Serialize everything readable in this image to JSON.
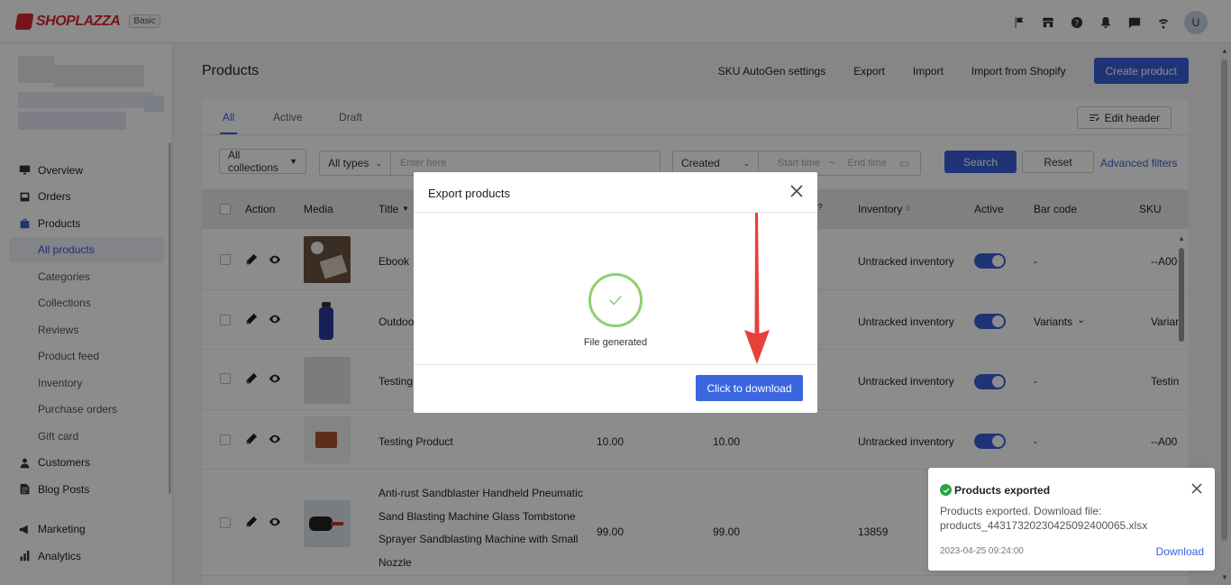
{
  "topbar": {
    "logo_text": "SHOPLAZZA",
    "plan_badge": "Basic",
    "icons": [
      "flag-icon",
      "store-icon",
      "help-icon",
      "bell-icon",
      "chat-icon",
      "wifi-icon"
    ],
    "avatar_initial": "U"
  },
  "sidebar": {
    "items": [
      {
        "label": "Overview",
        "icon": "overview-icon"
      },
      {
        "label": "Orders",
        "icon": "orders-icon"
      },
      {
        "label": "Products",
        "icon": "products-icon"
      }
    ],
    "product_subitems": [
      "All products",
      "Categories",
      "Collections",
      "Reviews",
      "Product feed",
      "Inventory",
      "Purchase orders",
      "Gift card"
    ],
    "lower_items": [
      {
        "label": "Customers",
        "icon": "customers-icon"
      },
      {
        "label": "Blog Posts",
        "icon": "blog-icon"
      }
    ],
    "bottom_items": [
      {
        "label": "Marketing",
        "icon": "marketing-icon"
      },
      {
        "label": "Analytics",
        "icon": "analytics-icon"
      }
    ]
  },
  "page": {
    "title": "Products",
    "actions": [
      "SKU AutoGen settings",
      "Export",
      "Import",
      "Import from Shopify"
    ],
    "create_button": "Create product"
  },
  "tabs": [
    "All",
    "Active",
    "Draft"
  ],
  "edit_header": "Edit header",
  "filters": {
    "collections": "All collections",
    "types": "All types",
    "search_placeholder": "Enter here",
    "date_field": "Created",
    "start_placeholder": "Start time",
    "tilde": "~",
    "end_placeholder": "End time",
    "search_button": "Search",
    "reset_button": "Reset",
    "advanced": "Advanced filters"
  },
  "table": {
    "headers": {
      "action": "Action",
      "media": "Media",
      "title": "Title",
      "inventory": "Inventory",
      "active": "Active",
      "barcode": "Bar code",
      "sku": "SKU"
    },
    "rows": [
      {
        "title": "Ebook",
        "price": "",
        "compare": "",
        "inventory": "Untracked inventory",
        "barcode": "-",
        "sku": "--A00"
      },
      {
        "title": "Outdoo",
        "price": "",
        "compare": "",
        "inventory": "Untracked inventory",
        "barcode": "Variants",
        "sku": "Variar"
      },
      {
        "title": "Testing",
        "price": "",
        "compare": "",
        "inventory": "Untracked inventory",
        "barcode": "-",
        "sku": "Testin"
      },
      {
        "title": "Testing Product",
        "price": "10.00",
        "compare": "10.00",
        "inventory": "Untracked inventory",
        "barcode": "-",
        "sku": "--A00"
      },
      {
        "title_lines": [
          "Anti-rust Sandblaster Handheld Pneumatic",
          "Sand Blasting Machine Glass Tombstone",
          "Sprayer Sandblasting Machine with Small",
          "Nozzle"
        ],
        "price": "99.00",
        "compare": "99.00",
        "inventory": "13859"
      }
    ]
  },
  "modal": {
    "title": "Export products",
    "status": "File generated",
    "download_button": "Click to download"
  },
  "toast": {
    "title": "Products exported",
    "body_line1": "Products exported. Download file:",
    "body_line2": "products_443173202304250924000​65.xlsx",
    "time": "2023-04-25 09:24:00",
    "download": "Download"
  },
  "colors": {
    "primary": "#3a5fd9",
    "brand": "#d7262e",
    "success": "#8fcf74",
    "arrow": "#e8403a"
  }
}
